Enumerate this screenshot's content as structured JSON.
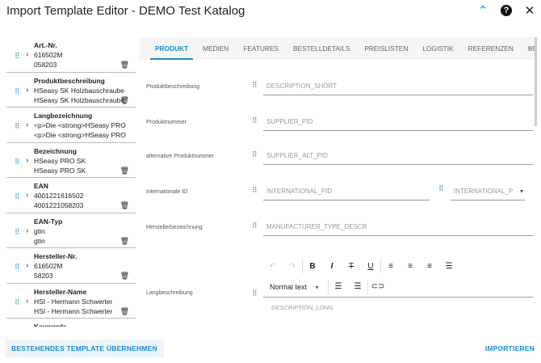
{
  "title": "Import Template Editor - DEMO Test Katalog",
  "header_icons": [
    "chevron-up-icon",
    "help-icon",
    "close-icon"
  ],
  "fields": [
    {
      "label": "Art.-Nr.",
      "values": [
        "616502M",
        "058203"
      ],
      "deletable": true
    },
    {
      "label": "Produktbeschreibung",
      "values": [
        "HSeasy SK Holzbauschraube",
        "HSeasy SK Holzbauschraube"
      ],
      "deletable": true
    },
    {
      "label": "Langbezeichnung",
      "values": [
        "<p>Die <strong>HSeasy PRO",
        "<p>Die <strong>HSeasy PRO"
      ],
      "deletable": false
    },
    {
      "label": "Bezeichnung",
      "values": [
        "HSeasy PRO SK",
        "HSeasy PRO SK"
      ],
      "deletable": true
    },
    {
      "label": "EAN",
      "values": [
        "4001221616502",
        "4001221058203"
      ],
      "deletable": true
    },
    {
      "label": "EAN-Typ",
      "values": [
        "gtin",
        "gtin"
      ],
      "deletable": true
    },
    {
      "label": "Hersteller-Nr.",
      "values": [
        "616502M",
        "58203"
      ],
      "deletable": true
    },
    {
      "label": "Hersteller-Name",
      "values": [
        "HSI - Hermann Schwerter",
        "HSI - Hermann Schwerter"
      ],
      "deletable": true
    },
    {
      "label": "Keywords",
      "values": [],
      "deletable": false
    }
  ],
  "tabs": [
    "PRODUKT",
    "MEDIEN",
    "FEATURES",
    "BESTELLDETAILS",
    "PREISLISTEN",
    "LOGISTIK",
    "REFERENZEN",
    "UD"
  ],
  "active_tab": "PRODUKT",
  "form": {
    "produktbeschreibung": {
      "label": "Produktbeschreibung",
      "value": "DESCRIPTION_SHORT"
    },
    "produktnummer": {
      "label": "Produktnummer",
      "value": "SUPPLIER_PID"
    },
    "alt_produktnummer": {
      "label": "alternative Produktnummer",
      "value": "SUPPLIER_ALT_PID"
    },
    "internationale_id": {
      "label": "Internationale ID",
      "value": "INTERNATIONAL_PID",
      "type_value": "INTERNATIONAL_P"
    },
    "herstellerbezeichnung": {
      "label": "Herstellerbezeichnung",
      "value": "MANUFACTURER_TYPE_DESCR"
    },
    "langbeschreibung": {
      "label": "Langbeschreibung",
      "value": "DESCRIPTION_LONG",
      "format": "Normal text"
    }
  },
  "buttons": {
    "apply": "BESTEHENDES TEMPLATE ÜBERNEHMEN",
    "import": "IMPORTIEREN"
  }
}
